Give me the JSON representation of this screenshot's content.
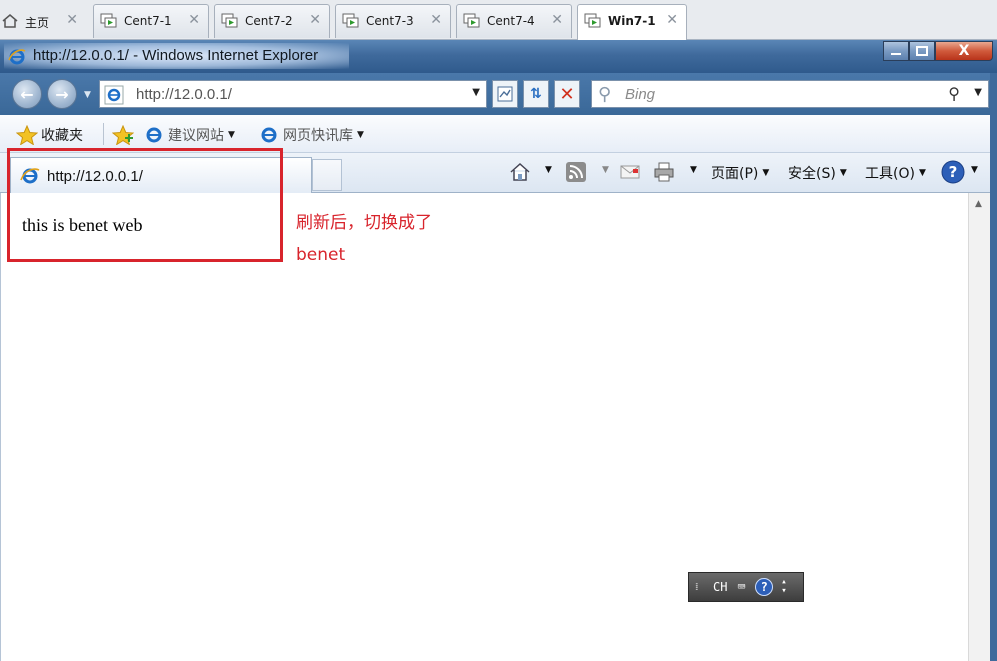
{
  "vm_tabs": [
    {
      "label": "主页",
      "icon": "home-icon"
    },
    {
      "label": "Cent7-1",
      "icon": "vm-icon"
    },
    {
      "label": "Cent7-2",
      "icon": "vm-icon"
    },
    {
      "label": "Cent7-3",
      "icon": "vm-icon"
    },
    {
      "label": "Cent7-4",
      "icon": "vm-icon"
    },
    {
      "label": "Win7-1",
      "icon": "vm-icon",
      "active": true
    }
  ],
  "window": {
    "title": "http://12.0.0.1/ - Windows Internet Explorer",
    "close_label": "X"
  },
  "nav": {
    "address": "http://12.0.0.1/",
    "search_placeholder": "Bing"
  },
  "favorites": {
    "favorites_label": "收藏夹",
    "suggested_sites_label": "建议网站",
    "web_slice_gallery_label": "网页快讯库"
  },
  "tab": {
    "url": "http://12.0.0.1/"
  },
  "commands": {
    "page_label": "页面(P)",
    "safety_label": "安全(S)",
    "tools_label": "工具(O)"
  },
  "content": {
    "page_text": "this is benet web"
  },
  "annotation": {
    "text": "刷新后，切换成了benet",
    "color": "#d8242c"
  },
  "language_bar": {
    "language": "CH"
  },
  "colors": {
    "title_bar": "#3f6a9c",
    "close_button": "#d05a3c",
    "annotation": "#d8242c"
  }
}
